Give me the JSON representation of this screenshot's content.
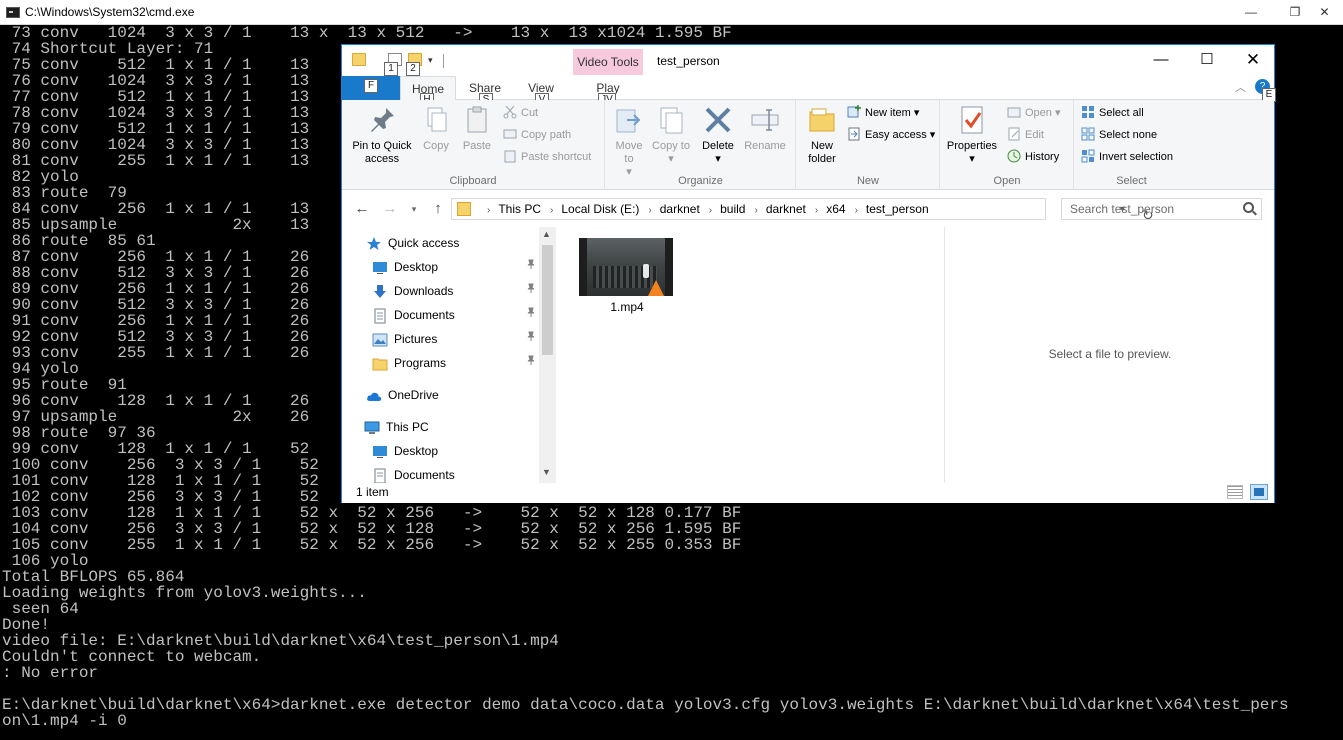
{
  "cmd": {
    "title": "C:\\Windows\\System32\\cmd.exe",
    "controls": {
      "minimize": "—",
      "maximize": "❐",
      "close": "✕"
    },
    "lines": [
      " 73 conv   1024  3 x 3 / 1    13 x  13 x 512   ->    13 x  13 x1024 1.595 BF",
      " 74 Shortcut Layer: 71",
      " 75 conv    512  1 x 1 / 1    13",
      " 76 conv   1024  3 x 3 / 1    13",
      " 77 conv    512  1 x 1 / 1    13",
      " 78 conv   1024  3 x 3 / 1    13",
      " 79 conv    512  1 x 1 / 1    13",
      " 80 conv   1024  3 x 3 / 1    13",
      " 81 conv    255  1 x 1 / 1    13",
      " 82 yolo",
      " 83 route  79",
      " 84 conv    256  1 x 1 / 1    13",
      " 85 upsample            2x    13",
      " 86 route  85 61",
      " 87 conv    256  1 x 1 / 1    26",
      " 88 conv    512  3 x 3 / 1    26",
      " 89 conv    256  1 x 1 / 1    26",
      " 90 conv    512  3 x 3 / 1    26",
      " 91 conv    256  1 x 1 / 1    26",
      " 92 conv    512  3 x 3 / 1    26",
      " 93 conv    255  1 x 1 / 1    26",
      " 94 yolo",
      " 95 route  91",
      " 96 conv    128  1 x 1 / 1    26",
      " 97 upsample            2x    26",
      " 98 route  97 36",
      " 99 conv    128  1 x 1 / 1    52",
      " 100 conv    256  3 x 3 / 1    52",
      " 101 conv    128  1 x 1 / 1    52",
      " 102 conv    256  3 x 3 / 1    52",
      " 103 conv    128  1 x 1 / 1    52 x  52 x 256   ->    52 x  52 x 128 0.177 BF",
      " 104 conv    256  3 x 3 / 1    52 x  52 x 128   ->    52 x  52 x 256 1.595 BF",
      " 105 conv    255  1 x 1 / 1    52 x  52 x 256   ->    52 x  52 x 255 0.353 BF",
      " 106 yolo",
      "Total BFLOPS 65.864",
      "Loading weights from yolov3.weights...",
      " seen 64",
      "Done!",
      "video file: E:\\darknet\\build\\darknet\\x64\\test_person\\1.mp4",
      "Couldn't connect to webcam.",
      ": No error",
      "",
      "E:\\darknet\\build\\darknet\\x64>darknet.exe detector demo data\\coco.data yolov3.cfg yolov3.weights E:\\darknet\\build\\darknet\\x64\\test_pers",
      "on\\1.mp4 -i 0"
    ]
  },
  "explorer": {
    "title": "test_person",
    "contextual_tab": "Video Tools",
    "controls": {
      "minimize": "—",
      "maximize": "☐",
      "close": "✕"
    },
    "quick_access_dropdown": "▾",
    "keytips": {
      "qa1": "1",
      "qa2": "2",
      "file": "F",
      "home": "H",
      "share": "S",
      "view": "V",
      "play": "JV",
      "expand": "E"
    },
    "help": "?",
    "ribbon_collapse": "︿",
    "tabs": {
      "home": "Home",
      "share": "Share",
      "view": "View",
      "play": "Play"
    },
    "ribbon": {
      "clipboard": {
        "label": "Clipboard",
        "pin": "Pin to Quick access",
        "copy": "Copy",
        "paste": "Paste",
        "cut": "Cut",
        "copy_path": "Copy path",
        "paste_shortcut": "Paste shortcut"
      },
      "organize": {
        "label": "Organize",
        "move_to": "Move to",
        "copy_to": "Copy to",
        "delete": "Delete",
        "rename": "Rename"
      },
      "new": {
        "label": "New",
        "new_folder": "New folder",
        "new_item": "New item",
        "easy_access": "Easy access"
      },
      "open": {
        "label": "Open",
        "properties": "Properties",
        "open": "Open",
        "edit": "Edit",
        "history": "History"
      },
      "select": {
        "label": "Select",
        "select_all": "Select all",
        "select_none": "Select none",
        "invert": "Invert selection"
      }
    },
    "nav": {
      "back": "←",
      "forward": "→",
      "recent": "▾",
      "up": "↑",
      "refresh": "↻",
      "address_dropdown": "▾"
    },
    "breadcrumbs": [
      "This PC",
      "Local Disk (E:)",
      "darknet",
      "build",
      "darknet",
      "x64",
      "test_person"
    ],
    "breadcrumb_sep": "›",
    "search_placeholder": "Search test_person",
    "nav_pane": {
      "items": [
        {
          "label": "Quick access",
          "pinned": false
        },
        {
          "label": "Desktop",
          "pinned": true
        },
        {
          "label": "Downloads",
          "pinned": true
        },
        {
          "label": "Documents",
          "pinned": true
        },
        {
          "label": "Pictures",
          "pinned": true
        },
        {
          "label": "Programs",
          "pinned": true
        },
        {
          "label": "OneDrive",
          "pinned": false
        },
        {
          "label": "This PC",
          "pinned": false
        },
        {
          "label": "Desktop",
          "pinned": false
        },
        {
          "label": "Documents",
          "pinned": false
        }
      ],
      "pin_glyph": "📌",
      "scroll_up": "▲",
      "scroll_down": "▼"
    },
    "files": [
      {
        "name": "1.mp4"
      }
    ],
    "preview_text": "Select a file to preview.",
    "status": "1 item",
    "colors": {
      "accent": "#1979ca",
      "contextual": "#f6c9dd",
      "folder": "#f6d26b"
    }
  }
}
